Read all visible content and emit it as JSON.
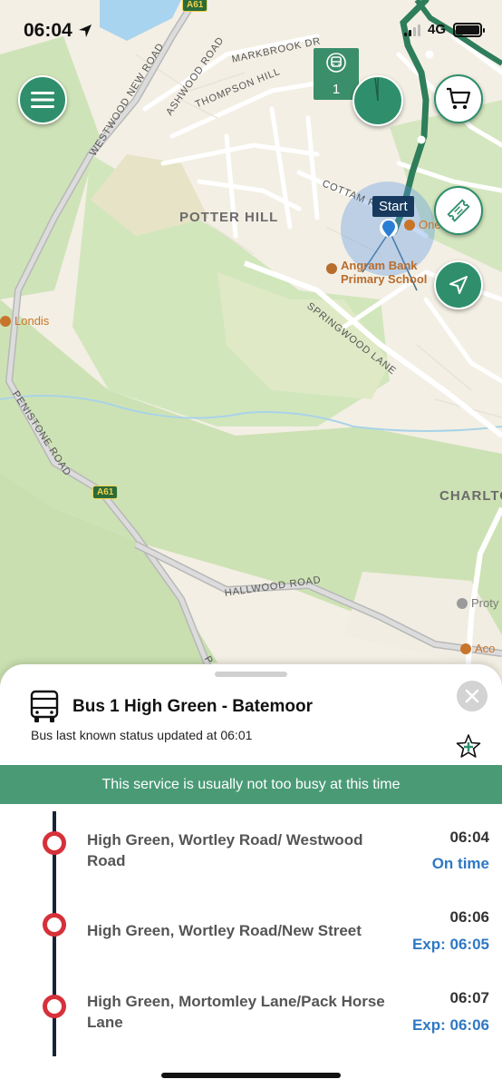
{
  "status_bar": {
    "time": "06:04",
    "network": "4G"
  },
  "map": {
    "area_labels": {
      "potter_hill": "POTTER HILL",
      "charlton": "CHARLTO"
    },
    "roads": {
      "westwood_new_road": "WESTWOOD NEW ROAD",
      "ashwood_road": "ASHWOOD ROAD",
      "markbrook_dr": "MARKBROOK DR",
      "thompson_hill": "THOMPSON HILL",
      "cottam_road": "COTTAM RO",
      "springwood_lane": "SPRINGWOOD LANE",
      "penistone_road": "PENISTONE ROAD",
      "hallwood_road": "HALLWOOD ROAD",
      "penistone_road_tail": "P"
    },
    "shields": {
      "a61_top": "A61",
      "a61_mid": "A61"
    },
    "pois": {
      "londis": "Londis",
      "school_line1": "Angram Bank",
      "school_line2": "Primary School",
      "one": "One",
      "proty": "Proty",
      "aco": "Aco"
    },
    "bus_badge_number": "1",
    "start_label": "Start"
  },
  "sheet": {
    "service_title": "Bus 1 High Green - Batemoor",
    "status_line": "Bus last known status updated at 06:01",
    "busy_banner": "This service is usually not too busy at this time",
    "stops": [
      {
        "name": "High Green, Wortley Road/ Westwood Road",
        "scheduled": "06:04",
        "status": "On time"
      },
      {
        "name": "High Green, Wortley Road/New Street",
        "scheduled": "06:06",
        "status": "Exp: 06:05"
      },
      {
        "name": "High Green, Mortomley Lane/Pack Horse Lane",
        "scheduled": "06:07",
        "status": "Exp: 06:06"
      }
    ]
  },
  "colors": {
    "brand_green": "#2f8f6c",
    "banner_green": "#4a9a76",
    "route_green": "#2e7d5b",
    "stop_red": "#d6313a",
    "status_blue": "#2f78c4"
  },
  "icons": [
    "location-arrow-icon",
    "menu-icon",
    "bus-icon",
    "cart-icon",
    "ticket-icon",
    "navigation-icon",
    "close-icon",
    "star-add-icon"
  ]
}
